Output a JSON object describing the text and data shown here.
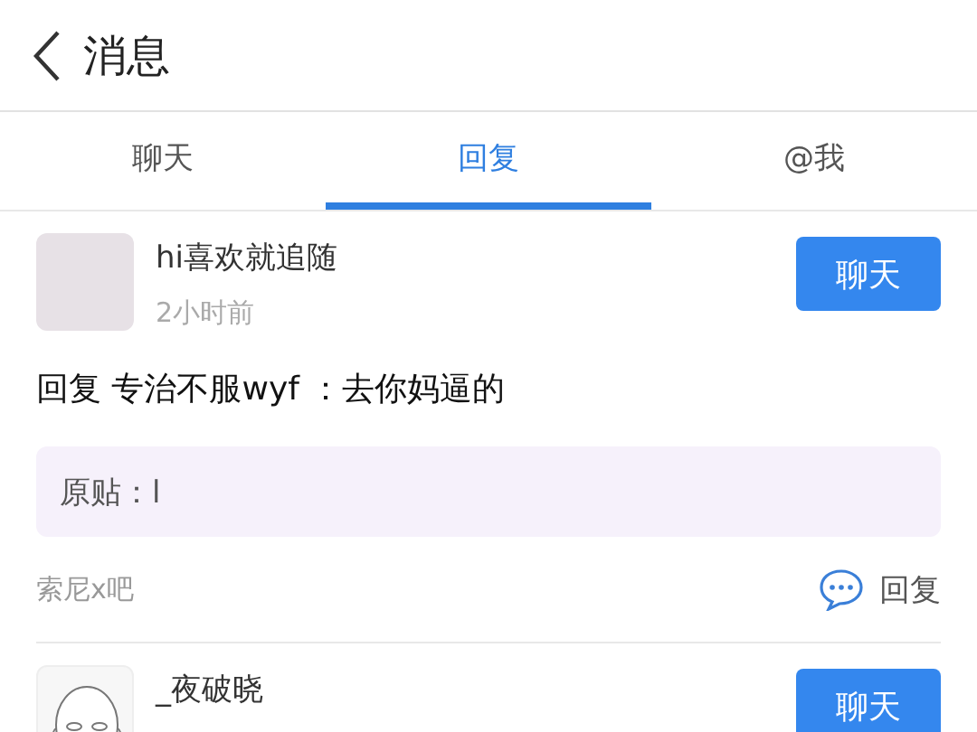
{
  "header": {
    "title": "消息"
  },
  "tabs": [
    {
      "label": "聊天",
      "selected": false
    },
    {
      "label": "回复",
      "selected": true
    },
    {
      "label": "@我",
      "selected": false
    }
  ],
  "replies": [
    {
      "avatar": {
        "kind": "photo"
      },
      "user": "hi喜欢就追随",
      "time": "2小时前",
      "chat_button": "聊天",
      "content": "回复 专治不服wyf ：去你妈逼的",
      "quote": "原贴：l",
      "forum": "索尼x吧",
      "reply_button": "回复"
    },
    {
      "avatar": {
        "kind": "drawing"
      },
      "user": "_夜破晓",
      "chat_button": "聊天"
    }
  ]
}
